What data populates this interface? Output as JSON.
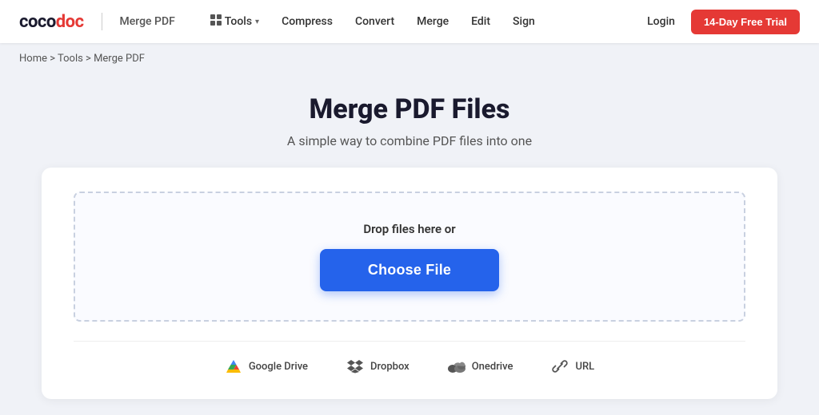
{
  "logo": {
    "coco": "coco",
    "doc": "doc",
    "divider_label": "|",
    "subtitle": "Merge PDF"
  },
  "nav": {
    "tools_label": "Tools",
    "compress_label": "Compress",
    "convert_label": "Convert",
    "merge_label": "Merge",
    "edit_label": "Edit",
    "sign_label": "Sign",
    "login_label": "Login",
    "trial_label": "14-Day Free Trial"
  },
  "breadcrumb": {
    "home": "Home",
    "sep1": " > ",
    "tools": "Tools",
    "sep2": " > ",
    "current": "Merge PDF"
  },
  "page": {
    "title": "Merge PDF Files",
    "subtitle": "A simple way to combine PDF files into one"
  },
  "dropzone": {
    "drop_text": "Drop files here or",
    "choose_label": "Choose File"
  },
  "cloud_sources": [
    {
      "id": "google-drive",
      "label": "Google Drive",
      "icon": "gdrive"
    },
    {
      "id": "dropbox",
      "label": "Dropbox",
      "icon": "dropbox"
    },
    {
      "id": "onedrive",
      "label": "Onedrive",
      "icon": "onedrive"
    },
    {
      "id": "url",
      "label": "URL",
      "icon": "link"
    }
  ]
}
